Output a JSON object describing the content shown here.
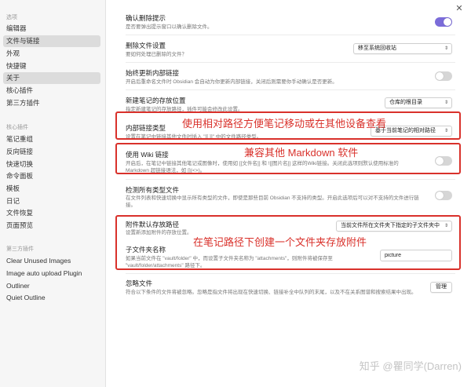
{
  "sidebar": {
    "section_options": "选项",
    "items_options": [
      {
        "label": "编辑器"
      },
      {
        "label": "文件与链接"
      },
      {
        "label": "外观"
      },
      {
        "label": "快捷键"
      },
      {
        "label": "关于"
      },
      {
        "label": "核心插件"
      },
      {
        "label": "第三方插件"
      }
    ],
    "section_core": "核心插件",
    "items_core": [
      {
        "label": "笔记重组"
      },
      {
        "label": "反向链接"
      },
      {
        "label": "快速切换"
      },
      {
        "label": "命令面板"
      },
      {
        "label": "模板"
      },
      {
        "label": "日记"
      },
      {
        "label": "文件恢复"
      },
      {
        "label": "页面预览"
      }
    ],
    "section_third": "第三方插件",
    "items_third": [
      {
        "label": "Clear Unused Images"
      },
      {
        "label": "Image auto upload Plugin"
      },
      {
        "label": "Outliner"
      },
      {
        "label": "Quiet Outline"
      }
    ]
  },
  "settings": {
    "confirm_delete": {
      "title": "确认删除提示",
      "desc": "是否要弹出提示窗口以确认删除文件。",
      "toggle": true
    },
    "delete_files": {
      "title": "删除文件设置",
      "desc": "要如何处理已删除的文件？",
      "value": "移至系统回收站"
    },
    "auto_update_links": {
      "title": "始终更新内部链接",
      "desc": "开启后重命名文件时 Obsidian 会自动为你更新内部链接，关闭后则需要你手动确认是否更新。",
      "toggle": false
    },
    "new_note_location": {
      "title": "新建笔记的存放位置",
      "desc": "指定新建笔记的存放路径，插件可能会修改此设置。",
      "value": "仓库的根目录"
    },
    "link_format": {
      "title": "内部链接类型",
      "desc": "设置在笔记中链接其他文件时插入 \"[[ ]]\" 中的文件路径类型。",
      "value": "基于当前笔记的相对路径"
    },
    "wiki_links": {
      "title": "使用 Wiki 链接",
      "desc1": "开启后，在笔记中链接其他笔记或图像时，使用如 [[文件名]] 和 ![[图片名]] 这样的Wiki链接。关闭此选项则默认使用标准的",
      "desc2": "Markdown 超链接语法，如 [](<>)。",
      "toggle": false
    },
    "detect_all": {
      "title": "检测所有类型文件",
      "desc1": "在文件列表和快速切换中显示所有类型的文件，即使是那些目前 Obsidian 不支持的类型。开启此选项后可以对不支持的文件进行链",
      "desc2": "接。",
      "toggle": false
    },
    "attachment_location": {
      "title": "附件默认存放路径",
      "desc": "设置新添加附件的存放位置。",
      "value": "当前文件所在文件夹下指定的子文件夹中"
    },
    "subfolder_name": {
      "title": "子文件夹名称",
      "desc1": "如果当前文件在 \"vault/folder\" 中，而设置子文件夹名称为 \"attachments\"，则附件将被保存至",
      "desc2": "\"vault/folder/attachments\" 路径下。",
      "value": "picture"
    },
    "ignore_files": {
      "title": "忽略文件",
      "desc": "符合以下条件的文件将被忽略。忽略是指文件将出现在快速切换、链接补全中队列的末尾，以及不在关系图谱和搜索结果中出现。",
      "button": "管理"
    }
  },
  "annotations": {
    "relative_path": "使用相对路径方便笔记移动或在其他设备查看",
    "markdown_compat": "兼容其他 Markdown 软件",
    "subfolder": "在笔记路径下创建一个文件夹存放附件"
  },
  "watermark": "知乎 @瞿同学(Darren)",
  "colors": {
    "accent": "#7b6cd9",
    "annotation": "#d9312b"
  }
}
